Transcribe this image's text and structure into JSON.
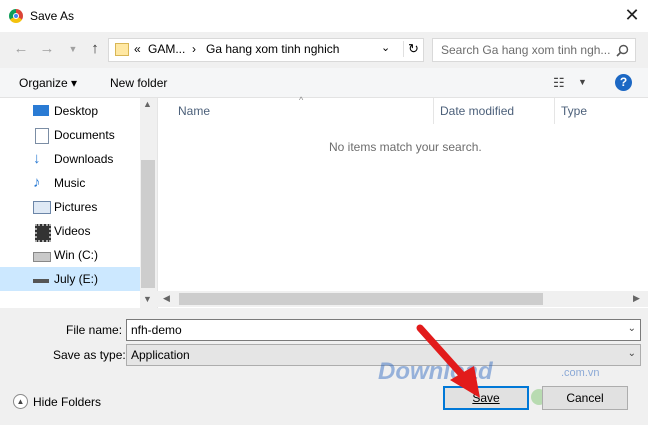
{
  "window": {
    "title": "Save As",
    "close_icon": "close-icon",
    "app_icon": "chrome-icon"
  },
  "nav": {
    "back_icon": "arrow-left-icon",
    "forward_icon": "arrow-right-icon",
    "recent_icon": "chevron-down-icon",
    "up_icon": "arrow-up-icon"
  },
  "address": {
    "prefix": "«",
    "crumbs": [
      "GAM...",
      "Ga hang xom tinh nghich"
    ],
    "separator": "›",
    "refresh_icon": "refresh-icon"
  },
  "search": {
    "placeholder": "Search Ga hang xom tinh ngh...",
    "icon": "search-icon"
  },
  "toolbar": {
    "organize": "Organize ▾",
    "new_folder": "New folder",
    "view_icon": "view-icon",
    "help": "?"
  },
  "sidebar": {
    "items": [
      {
        "label": "Desktop",
        "icon": "desktop-icon"
      },
      {
        "label": "Documents",
        "icon": "documents-icon"
      },
      {
        "label": "Downloads",
        "icon": "downloads-icon"
      },
      {
        "label": "Music",
        "icon": "music-icon"
      },
      {
        "label": "Pictures",
        "icon": "pictures-icon"
      },
      {
        "label": "Videos",
        "icon": "videos-icon"
      },
      {
        "label": "Win (C:)",
        "icon": "drive-icon"
      },
      {
        "label": "July (E:)",
        "icon": "drive-icon",
        "selected": true
      }
    ]
  },
  "columns": {
    "name": "Name",
    "date_modified": "Date modified",
    "type": "Type"
  },
  "empty_message": "No items match your search.",
  "form": {
    "file_name_label": "File name:",
    "file_name_value": "nfh-demo",
    "save_type_label": "Save as type:",
    "save_type_value": "Application"
  },
  "footer": {
    "hide_folders": "Hide Folders",
    "save": "Save",
    "cancel": "Cancel"
  },
  "watermark": {
    "text": "Download",
    "sub": ".com.vn"
  },
  "colors": {
    "accent": "#0078d7",
    "arrow": "#e21b1b",
    "selected_bg": "#cce8ff"
  }
}
